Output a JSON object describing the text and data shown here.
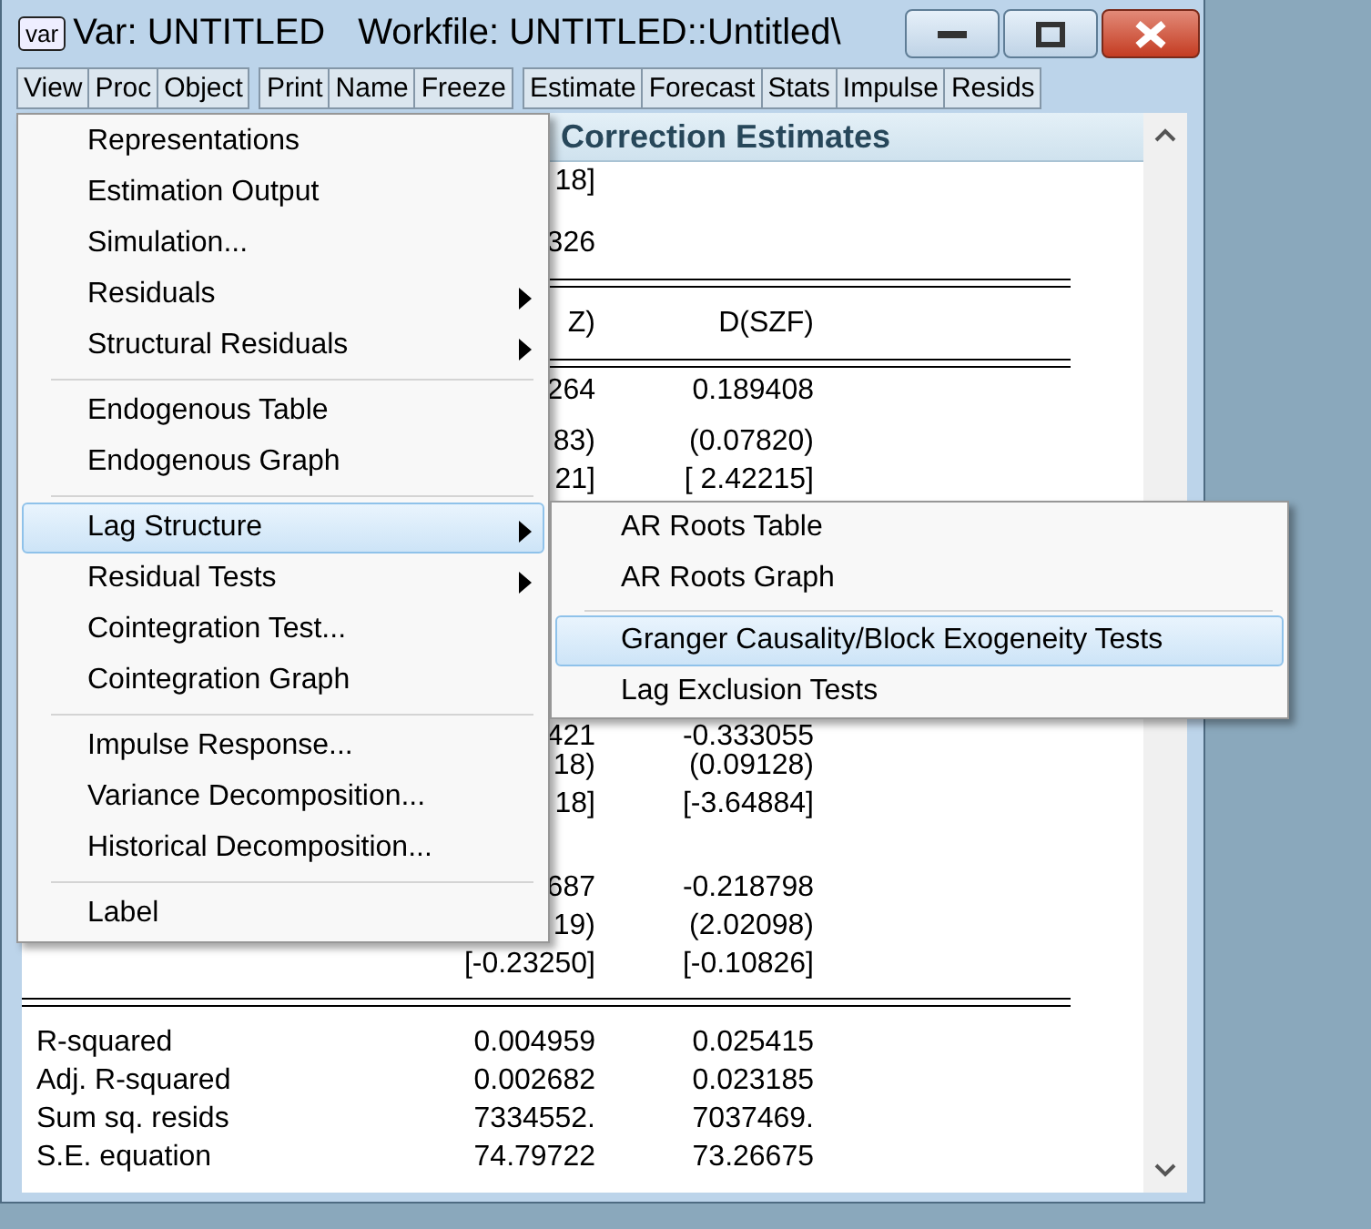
{
  "window": {
    "icon_text": "var",
    "title": "Var: UNTITLED",
    "subtitle": "Workfile: UNTITLED::Untitled\\"
  },
  "toolbar": [
    [
      "View",
      "Proc",
      "Object"
    ],
    [
      "Print",
      "Name",
      "Freeze"
    ],
    [
      "Estimate",
      "Forecast",
      "Stats",
      "Impulse",
      "Resids"
    ]
  ],
  "header": "Correction Estimates",
  "rows": [
    {
      "kind": "row",
      "column_1": "18]"
    },
    {
      "kind": "row",
      "column_1": "326"
    },
    {
      "kind": "rule"
    },
    {
      "kind": "row",
      "column_1": "Z)",
      "column_2": "D(SZF)"
    },
    {
      "kind": "rule"
    },
    {
      "kind": "row",
      "column_1": "264",
      "column_2": "0.189408"
    },
    {
      "kind": "row",
      "column_1": "83)",
      "column_2": "(0.07820)"
    },
    {
      "kind": "row",
      "column_1": "21]",
      "column_2": "[ 2.42215]"
    },
    {
      "kind": "row",
      "column_1": "421",
      "column_2": "-0.333055"
    },
    {
      "kind": "row",
      "column_1": "18)",
      "column_2": "(0.09128)"
    },
    {
      "kind": "row",
      "column_1": "18]",
      "column_2": "[-3.64884]"
    },
    {
      "kind": "row",
      "column_1": "687",
      "column_2": "-0.218798"
    },
    {
      "kind": "row",
      "column_1": "19)",
      "column_2": "(2.02098)"
    },
    {
      "kind": "row",
      "column_1": "[-0.23250]",
      "column_2": "[-0.10826]"
    },
    {
      "kind": "rule"
    },
    {
      "kind": "row",
      "label": "R-squared",
      "column_1": "0.004959",
      "column_2": "0.025415"
    },
    {
      "kind": "row",
      "label": "Adj. R-squared",
      "column_1": "0.002682",
      "column_2": "0.023185"
    },
    {
      "kind": "row",
      "label": "Sum sq. resids",
      "column_1": "7334552.",
      "column_2": "7037469."
    },
    {
      "kind": "row",
      "label": "S.E. equation",
      "column_1": "74.79722",
      "column_2": "73.26675"
    }
  ],
  "menu": {
    "items": [
      {
        "kind": "item",
        "label": "Representations",
        "submenu": false,
        "selected": false
      },
      {
        "kind": "item",
        "label": "Estimation Output",
        "submenu": false,
        "selected": false
      },
      {
        "kind": "item",
        "label": "Simulation...",
        "submenu": false,
        "selected": false
      },
      {
        "kind": "item",
        "label": "Residuals",
        "submenu": true,
        "selected": false
      },
      {
        "kind": "item",
        "label": "Structural Residuals",
        "submenu": true,
        "selected": false
      },
      {
        "kind": "separator"
      },
      {
        "kind": "item",
        "label": "Endogenous Table",
        "submenu": false,
        "selected": false
      },
      {
        "kind": "item",
        "label": "Endogenous Graph",
        "submenu": false,
        "selected": false
      },
      {
        "kind": "separator"
      },
      {
        "kind": "item",
        "label": "Lag Structure",
        "submenu": true,
        "selected": true
      },
      {
        "kind": "item",
        "label": "Residual Tests",
        "submenu": true,
        "selected": false
      },
      {
        "kind": "item",
        "label": "Cointegration Test...",
        "submenu": false,
        "selected": false
      },
      {
        "kind": "item",
        "label": "Cointegration Graph",
        "submenu": false,
        "selected": false
      },
      {
        "kind": "separator"
      },
      {
        "kind": "item",
        "label": "Impulse Response...",
        "submenu": false,
        "selected": false
      },
      {
        "kind": "item",
        "label": "Variance Decomposition...",
        "submenu": false,
        "selected": false
      },
      {
        "kind": "item",
        "label": "Historical Decomposition...",
        "submenu": false,
        "selected": false
      },
      {
        "kind": "separator"
      },
      {
        "kind": "item",
        "label": "Label",
        "submenu": false,
        "selected": false
      }
    ]
  },
  "submenu": {
    "items": [
      {
        "kind": "item",
        "label": "AR Roots Table",
        "selected": false
      },
      {
        "kind": "item",
        "label": "AR Roots Graph",
        "selected": false
      },
      {
        "kind": "separator"
      },
      {
        "kind": "item",
        "label": "Granger Causality/Block Exogeneity Tests",
        "selected": true
      },
      {
        "kind": "item",
        "label": "Lag Exclusion Tests",
        "selected": false
      }
    ]
  }
}
